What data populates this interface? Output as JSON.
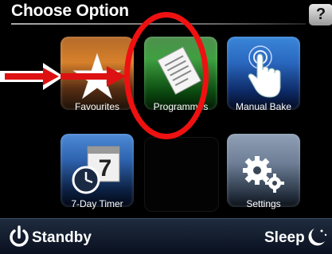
{
  "header": {
    "title": "Choose Option",
    "help_label": "?"
  },
  "tiles": [
    {
      "label": "Favourites"
    },
    {
      "label": "Programmes"
    },
    {
      "label": "Manual Bake"
    },
    {
      "label": "7-Day Timer"
    },
    {
      "label": ""
    },
    {
      "label": "Settings"
    }
  ],
  "timer_icon_number": "7",
  "bottom": {
    "standby_label": "Standby",
    "sleep_label": "Sleep"
  },
  "colors": {
    "highlight": "#e11111",
    "arrow": "#e11111"
  }
}
